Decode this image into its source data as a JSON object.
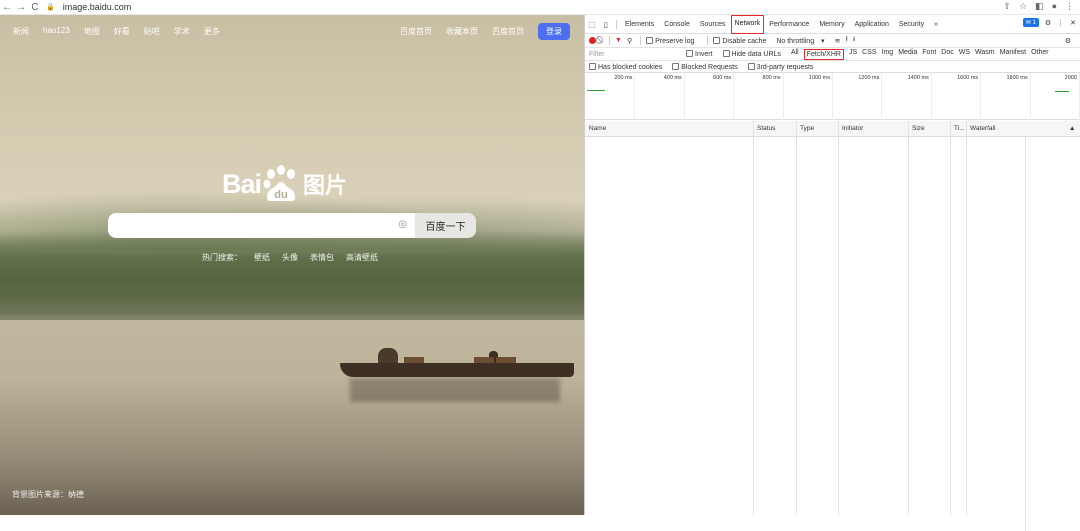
{
  "browser": {
    "url": "image.baidu.com",
    "nav_back": "←",
    "nav_forward": "→",
    "reload": "C",
    "lock": "🔒",
    "right_icons": [
      "⇪",
      "☆",
      "◧",
      "●",
      "⋮"
    ]
  },
  "page": {
    "nav_left": [
      "新闻",
      "hao123",
      "地图",
      "好看",
      "贴吧",
      "学术",
      "更多"
    ],
    "nav_right": [
      "百度首页",
      "收藏本页",
      "百度首页"
    ],
    "login": "登录",
    "logo_text": "Bai",
    "logo_du": "du",
    "logo_pic": "图片",
    "search_placeholder": "",
    "camera_icon": "◎",
    "search_button": "百度一下",
    "hot_label": "热门搜索：",
    "hot_items": [
      "壁纸",
      "头像",
      "表情包",
      "高清壁纸"
    ],
    "credit": "背景图片来源：纳德"
  },
  "devtools": {
    "tabs": [
      "Elements",
      "Console",
      "Sources",
      "Network",
      "Performance",
      "Memory",
      "Application",
      "Security",
      "»"
    ],
    "active_tab": "Network",
    "issues_badge": "1",
    "toolbar": {
      "preserve_log": "Preserve log",
      "disable_cache": "Disable cache",
      "throttling": "No throttling",
      "throttle_arrow": "▾",
      "wifi_icon": "≋",
      "upload_icon": "⭱",
      "download_icon": "⭳"
    },
    "filter": {
      "placeholder": "Filter",
      "invert": "Invert",
      "hide_data_urls": "Hide data URLs",
      "types": [
        "All",
        "Fetch/XHR",
        "JS",
        "CSS",
        "Img",
        "Media",
        "Font",
        "Doc",
        "WS",
        "Wasm",
        "Manifest",
        "Other"
      ],
      "highlighted_type": "Fetch/XHR",
      "has_blocked_cookies": "Has blocked cookies",
      "blocked_requests": "Blocked Requests",
      "third_party": "3rd-party requests"
    },
    "timeline_ticks": [
      "200 ms",
      "400 ms",
      "600 ms",
      "800 ms",
      "1000 ms",
      "1200 ms",
      "1400 ms",
      "1600 ms",
      "1800 ms",
      "2000"
    ],
    "columns": [
      "Name",
      "Status",
      "Type",
      "Initiator",
      "Size",
      "Ti...",
      "Waterfall"
    ],
    "sort_icon": "▲",
    "highlight_color": "#e32b2b"
  }
}
